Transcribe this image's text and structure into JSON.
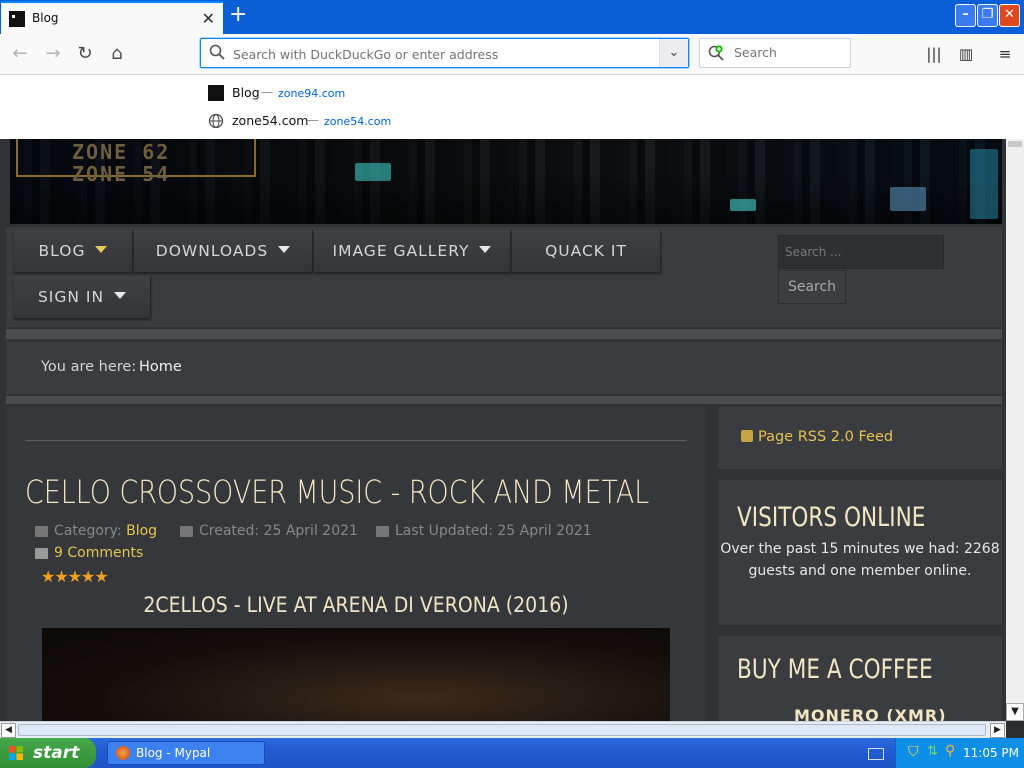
{
  "browser": {
    "tab_title": "Blog",
    "url_placeholder": "Search with DuckDuckGo or enter address",
    "search_placeholder": "Search",
    "suggestions": [
      {
        "title": "Blog",
        "url": "zone94.com"
      },
      {
        "title": "zone54.com",
        "url": "zone54.com"
      }
    ]
  },
  "site": {
    "banner_logo_line1": "ZONE 62",
    "banner_logo_line2": "ZONE 54",
    "menu": [
      {
        "label": "BLOG",
        "has_dropdown": true,
        "active": true
      },
      {
        "label": "DOWNLOADS",
        "has_dropdown": true
      },
      {
        "label": "IMAGE GALLERY",
        "has_dropdown": true
      },
      {
        "label": "QUACK IT",
        "has_dropdown": false
      },
      {
        "label": "SIGN IN",
        "has_dropdown": true
      }
    ],
    "search_placeholder": "Search ...",
    "search_button": "Search",
    "breadcrumb_label": "You are here:",
    "breadcrumb_home": "Home"
  },
  "article": {
    "title": "CELLO CROSSOVER MUSIC - ROCK AND METAL",
    "category_label": "Category:",
    "category": "Blog",
    "created": "Created: 25 April 2021",
    "updated": "Last Updated: 25 April 2021",
    "comments": "9 Comments",
    "rating_stars": 5,
    "stars_text": "★★★★★",
    "video_title": "2CELLOS - LIVE AT ARENA DI VERONA (2016)"
  },
  "sidebar": {
    "rss_label": "Page RSS 2.0 Feed",
    "visitors_heading": "VISITORS ONLINE",
    "visitors_text": "Over the past 15 minutes we had: 2268 guests and one member online.",
    "coffee_heading": "BUY ME A COFFEE",
    "coffee_sub": "MONERO (XMR)"
  },
  "taskbar": {
    "start_label": "start",
    "task_label": "Blog - Mypal",
    "clock": "11:05 PM"
  },
  "colors": {
    "accent_yellow": "#e6c34f",
    "heading_cream": "#f3e6c3",
    "firefox_blue": "#0a84ff",
    "xp_taskbar": "#225bd2"
  }
}
